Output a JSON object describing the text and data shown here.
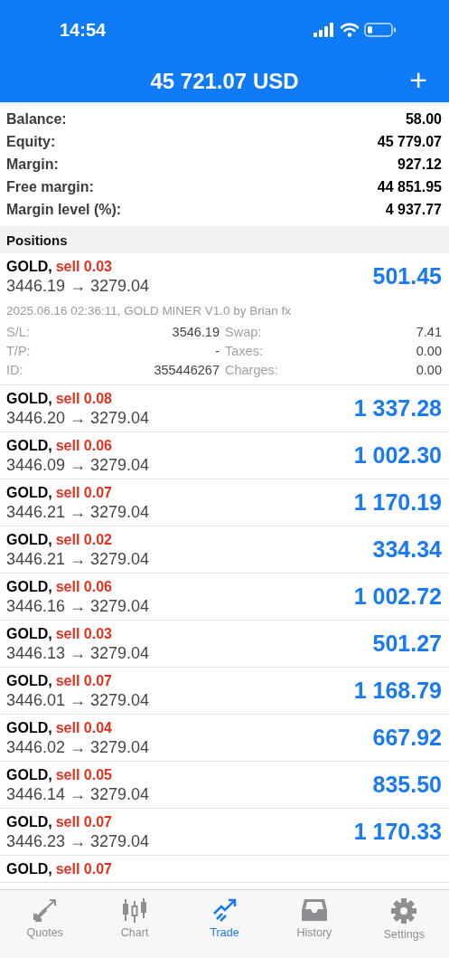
{
  "status_bar": {
    "time": "14:54"
  },
  "header": {
    "title": "45 721.07 USD",
    "add": "+"
  },
  "summary": [
    {
      "label": "Balance:",
      "value": "58.00"
    },
    {
      "label": "Equity:",
      "value": "45 779.07"
    },
    {
      "label": "Margin:",
      "value": "927.12"
    },
    {
      "label": "Free margin:",
      "value": "44 851.95"
    },
    {
      "label": "Margin level (%):",
      "value": "4 937.77"
    }
  ],
  "positions_heading": "Positions",
  "positions": [
    {
      "symbol": "GOLD,",
      "side": "sell 0.03",
      "prices": "3446.19 → 3279.04",
      "profit": "501.45",
      "expanded": true,
      "comment": "2025.06.16 02:36:11, GOLD MINER V1.0 by Brian fx",
      "details": [
        {
          "label": "S/L:",
          "value": "3546.19",
          "label2": "Swap:",
          "value2": "7.41"
        },
        {
          "label": "T/P:",
          "value": "-",
          "label2": "Taxes:",
          "value2": "0.00"
        },
        {
          "label": "ID:",
          "value": "355446267",
          "label2": "Charges:",
          "value2": "0.00"
        }
      ]
    },
    {
      "symbol": "GOLD,",
      "side": "sell 0.08",
      "prices": "3446.20 → 3279.04",
      "profit": "1 337.28",
      "expanded": false
    },
    {
      "symbol": "GOLD,",
      "side": "sell 0.06",
      "prices": "3446.09 → 3279.04",
      "profit": "1 002.30",
      "expanded": false
    },
    {
      "symbol": "GOLD,",
      "side": "sell 0.07",
      "prices": "3446.21 → 3279.04",
      "profit": "1 170.19",
      "expanded": false
    },
    {
      "symbol": "GOLD,",
      "side": "sell 0.02",
      "prices": "3446.21 → 3279.04",
      "profit": "334.34",
      "expanded": false
    },
    {
      "symbol": "GOLD,",
      "side": "sell 0.06",
      "prices": "3446.16 → 3279.04",
      "profit": "1 002.72",
      "expanded": false
    },
    {
      "symbol": "GOLD,",
      "side": "sell 0.03",
      "prices": "3446.13 → 3279.04",
      "profit": "501.27",
      "expanded": false
    },
    {
      "symbol": "GOLD,",
      "side": "sell 0.07",
      "prices": "3446.01 → 3279.04",
      "profit": "1 168.79",
      "expanded": false
    },
    {
      "symbol": "GOLD,",
      "side": "sell 0.04",
      "prices": "3446.02 → 3279.04",
      "profit": "667.92",
      "expanded": false
    },
    {
      "symbol": "GOLD,",
      "side": "sell 0.05",
      "prices": "3446.14 → 3279.04",
      "profit": "835.50",
      "expanded": false
    },
    {
      "symbol": "GOLD,",
      "side": "sell 0.07",
      "prices": "3446.23 → 3279.04",
      "profit": "1 170.33",
      "expanded": false
    },
    {
      "symbol": "GOLD,",
      "side": "sell 0.07",
      "expanded": false
    }
  ],
  "tabs": [
    {
      "label": "Quotes",
      "kind": "quotes",
      "selected": false
    },
    {
      "label": "Chart",
      "kind": "chart",
      "selected": false
    },
    {
      "label": "Trade",
      "kind": "trade",
      "selected": true
    },
    {
      "label": "History",
      "kind": "history",
      "selected": false
    },
    {
      "label": "Settings",
      "kind": "settings",
      "selected": false
    }
  ]
}
